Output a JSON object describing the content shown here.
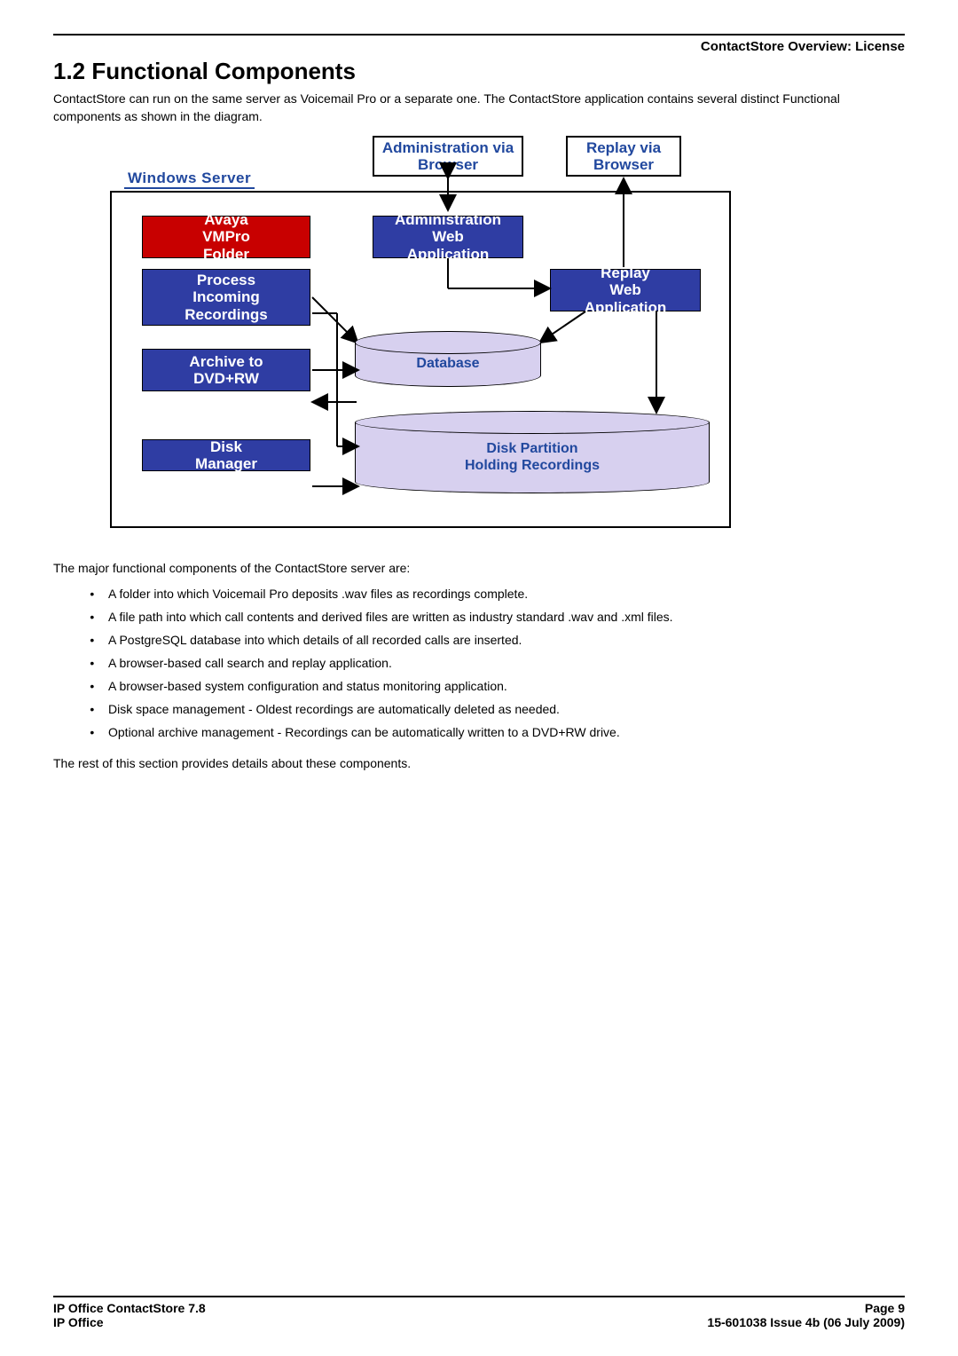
{
  "header": {
    "breadcrumb": "ContactStore Overview: License"
  },
  "section": {
    "number_title": "1.2 Functional Components",
    "intro": "ContactStore can run on the same server as Voicemail Pro or a separate one. The ContactStore application contains several distinct Functional components as shown in the diagram.",
    "lead_out": "The major functional components of the ContactStore server are:",
    "tail": "The rest of this section provides details about these components."
  },
  "diagram": {
    "server_label": "Windows Server",
    "admin_browser": "Administration via Browser",
    "replay_browser": "Replay via Browser",
    "avaya": "Avaya VMPro Folder",
    "process": "Process Incoming Recordings",
    "archive": "Archive to DVD+RW",
    "diskmgr": "Disk Manager",
    "admin_app": "Administration Web Application",
    "replay_app": "Replay Web Application",
    "database": "Database",
    "diskpart_l1": "Disk Partition",
    "diskpart_l2": "Holding Recordings"
  },
  "bullets": [
    "A folder into which Voicemail Pro deposits .wav files as recordings complete.",
    "A file path into which call contents and derived files are written as industry standard .wav and .xml files.",
    "A PostgreSQL database into which details of all recorded calls are inserted.",
    "A browser-based call search and replay application.",
    "A browser-based system configuration and status monitoring application.",
    "Disk space management - Oldest recordings are automatically deleted as needed.",
    "Optional archive management - Recordings can be automatically written to a DVD+RW drive."
  ],
  "footer": {
    "left1": "IP Office ContactStore 7.8",
    "left2": "IP Office",
    "right1": "Page 9",
    "right2": "15-601038 Issue 4b (06 July 2009)"
  }
}
